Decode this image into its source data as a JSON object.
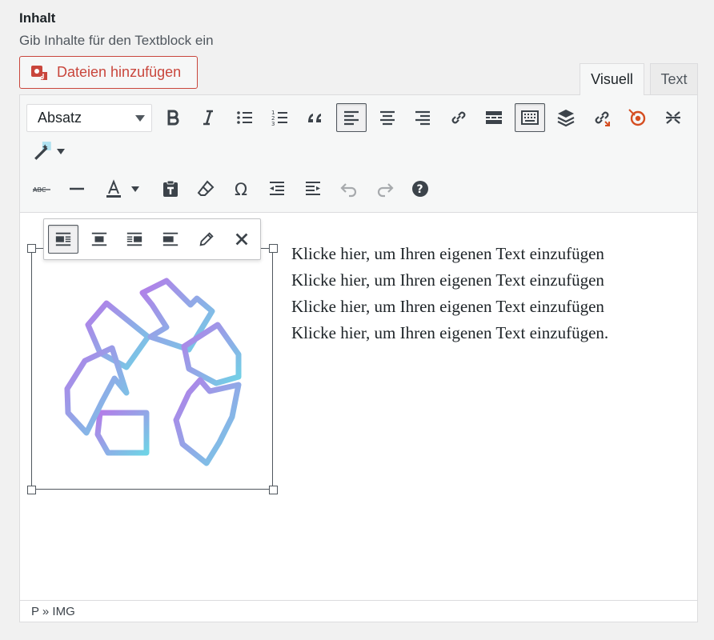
{
  "section": {
    "title": "Inhalt",
    "subtitle": "Gib Inhalte für den Textblock ein"
  },
  "media_button": {
    "label": "Dateien hinzufügen",
    "color": "#c9463c"
  },
  "mode_tabs": [
    {
      "label": "Visuell",
      "active": true
    },
    {
      "label": "Text",
      "active": false
    }
  ],
  "toolbar": {
    "format_select_value": "Absatz",
    "row1": [
      "bold",
      "italic",
      "bullet-list",
      "numbered-list",
      "blockquote",
      "align-left",
      "align-center",
      "align-right",
      "insert-link",
      "read-more",
      "toolbar-toggle",
      "layers",
      "unlink",
      "target",
      "fullscreen",
      "magic-wand"
    ],
    "row2": [
      "strikethrough",
      "horizontal-line",
      "text-color",
      "paste-as-text",
      "clear-formatting",
      "special-character",
      "outdent",
      "indent",
      "undo",
      "redo",
      "help"
    ]
  },
  "image_toolbar": {
    "buttons": [
      "align-left",
      "align-center",
      "align-right",
      "no-align",
      "edit",
      "remove"
    ]
  },
  "content": {
    "lines": [
      "Klicke hier, um Ihren eigenen Text einzufügen",
      "Klicke hier, um Ihren eigenen Text einzufügen",
      "Klicke hier, um Ihren eigenen Text einzufügen",
      "Klicke hier, um Ihren eigenen Text einzufügen."
    ]
  },
  "statusbar": {
    "path": "P » IMG"
  },
  "colors": {
    "accent_red": "#c9463c",
    "recycle_purple": "#b57be8",
    "recycle_cyan": "#6fd3e6"
  }
}
